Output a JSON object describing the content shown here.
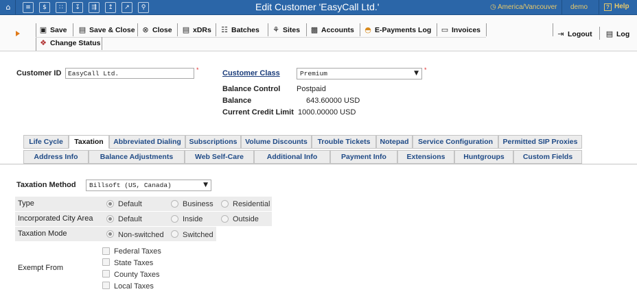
{
  "topbar": {
    "title": "Edit Customer 'EasyCall Ltd.'",
    "timezone": "America/Vancouver",
    "user": "demo",
    "help": "Help",
    "icons": [
      "home-icon",
      "list-icon",
      "dollar-icon",
      "grid-icon",
      "download-icon",
      "routing-icon",
      "upload-icon",
      "chart-icon",
      "search-icon"
    ]
  },
  "toolbar": {
    "save": "Save",
    "save_close": "Save & Close",
    "close": "Close",
    "xdrs": "xDRs",
    "batches": "Batches",
    "sites": "Sites",
    "accounts": "Accounts",
    "epayments": "E-Payments Log",
    "invoices": "Invoices",
    "change_status": "Change Status",
    "logout": "Logout",
    "log": "Log"
  },
  "customer": {
    "id_label": "Customer ID",
    "id_value": "EasyCall Ltd.",
    "class_label": "Customer Class",
    "class_value": "Premium",
    "balance_control_label": "Balance Control",
    "balance_control_value": "Postpaid",
    "balance_label": "Balance",
    "balance_value": "643.60000 USD",
    "credit_limit_label": "Current Credit Limit",
    "credit_limit_value": "1000.00000 USD"
  },
  "tabs": {
    "row1": [
      "Life Cycle",
      "Taxation",
      "Abbreviated Dialing",
      "Subscriptions",
      "Volume Discounts",
      "Trouble Tickets",
      "Notepad",
      "Service Configuration",
      "Permitted SIP Proxies"
    ],
    "row2": [
      "Address Info",
      "Balance Adjustments",
      "Web Self-Care",
      "Additional Info",
      "Payment Info",
      "Extensions",
      "Huntgroups",
      "Custom Fields"
    ],
    "active": "Taxation"
  },
  "taxation": {
    "method_label": "Taxation Method",
    "method_value": "Billsoft (US, Canada)",
    "type_label": "Type",
    "type_options": [
      "Default",
      "Business",
      "Residential"
    ],
    "type_selected": "Default",
    "city_label": "Incorporated City Area",
    "city_options": [
      "Default",
      "Inside",
      "Outside"
    ],
    "city_selected": "Default",
    "mode_label": "Taxation Mode",
    "mode_options": [
      "Non-switched",
      "Switched"
    ],
    "mode_selected": "Non-switched",
    "exempt_label": "Exempt From",
    "exempt_options": [
      "Federal Taxes",
      "State Taxes",
      "County Taxes",
      "Local Taxes"
    ]
  }
}
